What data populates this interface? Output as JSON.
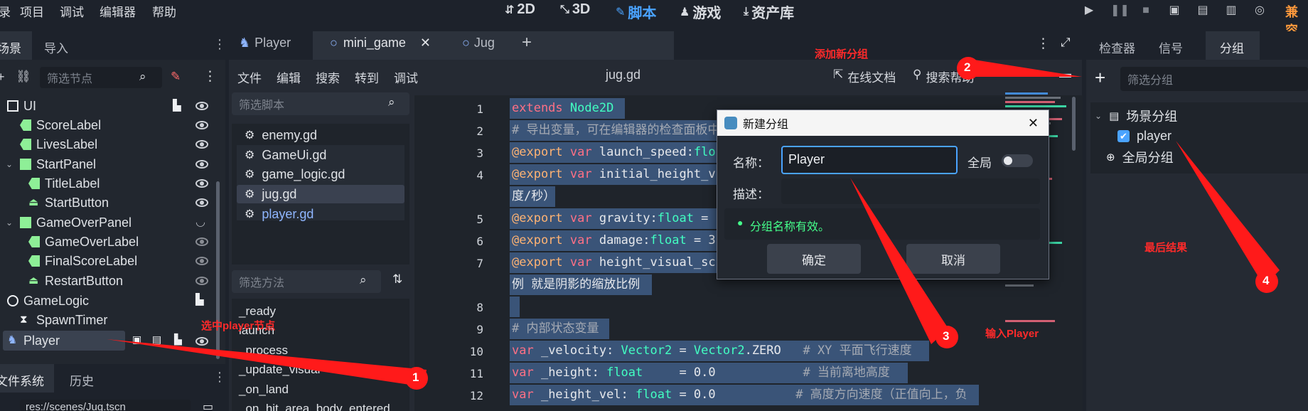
{
  "menu": [
    "录",
    "项目",
    "调试",
    "编辑器",
    "帮助"
  ],
  "workspaces": [
    {
      "label": "2D",
      "icon": "2d-icon"
    },
    {
      "label": "3D",
      "icon": "3d-icon"
    },
    {
      "label": "脚本",
      "icon": "script-icon"
    },
    {
      "label": "游戏",
      "icon": "game-icon"
    },
    {
      "label": "资产库",
      "icon": "asset-lib-icon"
    }
  ],
  "compat_label": "兼容",
  "left_dock": {
    "tabs": [
      "场景",
      "导入"
    ],
    "filter_placeholder": "筛选节点",
    "tree": [
      {
        "label": "UI"
      },
      {
        "label": "ScoreLabel"
      },
      {
        "label": "LivesLabel"
      },
      {
        "label": "StartPanel"
      },
      {
        "label": "TitleLabel"
      },
      {
        "label": "StartButton"
      },
      {
        "label": "GameOverPanel"
      },
      {
        "label": "GameOverLabel"
      },
      {
        "label": "FinalScoreLabel"
      },
      {
        "label": "RestartButton"
      },
      {
        "label": "GameLogic"
      },
      {
        "label": "SpawnTimer"
      },
      {
        "label": "Player"
      }
    ],
    "bottom_tabs": [
      "文件系统",
      "历史"
    ],
    "path": "res://scenes/Jug.tscn"
  },
  "editor_tabs": [
    "Player",
    "mini_game",
    "Jug"
  ],
  "script_menu": [
    "文件",
    "编辑",
    "搜索",
    "转到",
    "调试"
  ],
  "current_file": "jug.gd",
  "online_docs": "在线文档",
  "search_help": "搜索帮助",
  "script_filter_placeholder": "筛选脚本",
  "scripts": [
    "enemy.gd",
    "GameUi.gd",
    "game_logic.gd",
    "jug.gd",
    "player.gd"
  ],
  "method_filter_placeholder": "筛选方法",
  "methods": [
    "_ready",
    "launch",
    "_process",
    "_update_visual",
    "_on_land",
    "_on_hit_area_body_entered"
  ],
  "code_lines": [
    {
      "n": "1",
      "text": "extends Node2D"
    },
    {
      "n": "2",
      "text": "# 导出变量，可在编辑器的检查面板中"
    },
    {
      "n": "3",
      "text": "@export var launch_speed:flo"
    },
    {
      "n": "4",
      "text": "@export var initial_height_v"
    },
    {
      "n": "",
      "text": "度/秒）"
    },
    {
      "n": "5",
      "text": "@export var gravity:float = "
    },
    {
      "n": "6",
      "text": "@export var damage:float = 3"
    },
    {
      "n": "7",
      "text": "@export var height_visual_sc"
    },
    {
      "n": "",
      "text": "例 就是阴影的缩放比例"
    },
    {
      "n": "8",
      "text": ""
    },
    {
      "n": "9",
      "text": "# 内部状态变量"
    },
    {
      "n": "10",
      "text": "var _velocity: Vector2 = Vector2.ZERO   # XY 平面飞行速度"
    },
    {
      "n": "11",
      "text": "var _height: float     = 0.0            # 当前离地高度"
    },
    {
      "n": "12",
      "text": "var _height_vel: float = 0.0           # 高度方向速度（正值向上，负"
    }
  ],
  "dialog": {
    "title": "新建分组",
    "name_label": "名称：",
    "name_value": "Player",
    "global_label": "全局",
    "desc_label": "描述：",
    "valid_msg": "分组名称有效。",
    "ok": "确定",
    "cancel": "取消"
  },
  "right_dock": {
    "tabs": [
      "检查器",
      "信号",
      "分组"
    ],
    "filter_placeholder": "筛选分组",
    "scene_groups": "场景分组",
    "group_item": "player",
    "global_groups": "全局分组"
  },
  "annotations": {
    "select_player": "选中player节点",
    "add_group": "添加新分组",
    "input_player": "输入Player",
    "final_result": "最后结果",
    "n1": "1",
    "n2": "2",
    "n3": "3",
    "n4": "4"
  },
  "colors": {
    "accent": "#4aa3ff",
    "selection": "#3a5478",
    "annotation": "#ff2a2a",
    "valid": "#45ff8b"
  }
}
